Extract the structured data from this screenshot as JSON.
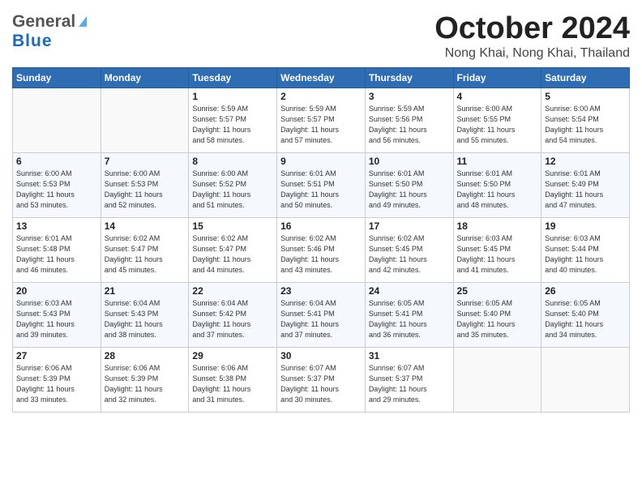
{
  "header": {
    "logo_line1": "General",
    "logo_line2": "Blue",
    "month_title": "October 2024",
    "location": "Nong Khai, Nong Khai, Thailand"
  },
  "weekdays": [
    "Sunday",
    "Monday",
    "Tuesday",
    "Wednesday",
    "Thursday",
    "Friday",
    "Saturday"
  ],
  "weeks": [
    [
      {
        "day": "",
        "info": ""
      },
      {
        "day": "",
        "info": ""
      },
      {
        "day": "1",
        "info": "Sunrise: 5:59 AM\nSunset: 5:57 PM\nDaylight: 11 hours\nand 58 minutes."
      },
      {
        "day": "2",
        "info": "Sunrise: 5:59 AM\nSunset: 5:57 PM\nDaylight: 11 hours\nand 57 minutes."
      },
      {
        "day": "3",
        "info": "Sunrise: 5:59 AM\nSunset: 5:56 PM\nDaylight: 11 hours\nand 56 minutes."
      },
      {
        "day": "4",
        "info": "Sunrise: 6:00 AM\nSunset: 5:55 PM\nDaylight: 11 hours\nand 55 minutes."
      },
      {
        "day": "5",
        "info": "Sunrise: 6:00 AM\nSunset: 5:54 PM\nDaylight: 11 hours\nand 54 minutes."
      }
    ],
    [
      {
        "day": "6",
        "info": "Sunrise: 6:00 AM\nSunset: 5:53 PM\nDaylight: 11 hours\nand 53 minutes."
      },
      {
        "day": "7",
        "info": "Sunrise: 6:00 AM\nSunset: 5:53 PM\nDaylight: 11 hours\nand 52 minutes."
      },
      {
        "day": "8",
        "info": "Sunrise: 6:00 AM\nSunset: 5:52 PM\nDaylight: 11 hours\nand 51 minutes."
      },
      {
        "day": "9",
        "info": "Sunrise: 6:01 AM\nSunset: 5:51 PM\nDaylight: 11 hours\nand 50 minutes."
      },
      {
        "day": "10",
        "info": "Sunrise: 6:01 AM\nSunset: 5:50 PM\nDaylight: 11 hours\nand 49 minutes."
      },
      {
        "day": "11",
        "info": "Sunrise: 6:01 AM\nSunset: 5:50 PM\nDaylight: 11 hours\nand 48 minutes."
      },
      {
        "day": "12",
        "info": "Sunrise: 6:01 AM\nSunset: 5:49 PM\nDaylight: 11 hours\nand 47 minutes."
      }
    ],
    [
      {
        "day": "13",
        "info": "Sunrise: 6:01 AM\nSunset: 5:48 PM\nDaylight: 11 hours\nand 46 minutes."
      },
      {
        "day": "14",
        "info": "Sunrise: 6:02 AM\nSunset: 5:47 PM\nDaylight: 11 hours\nand 45 minutes."
      },
      {
        "day": "15",
        "info": "Sunrise: 6:02 AM\nSunset: 5:47 PM\nDaylight: 11 hours\nand 44 minutes."
      },
      {
        "day": "16",
        "info": "Sunrise: 6:02 AM\nSunset: 5:46 PM\nDaylight: 11 hours\nand 43 minutes."
      },
      {
        "day": "17",
        "info": "Sunrise: 6:02 AM\nSunset: 5:45 PM\nDaylight: 11 hours\nand 42 minutes."
      },
      {
        "day": "18",
        "info": "Sunrise: 6:03 AM\nSunset: 5:45 PM\nDaylight: 11 hours\nand 41 minutes."
      },
      {
        "day": "19",
        "info": "Sunrise: 6:03 AM\nSunset: 5:44 PM\nDaylight: 11 hours\nand 40 minutes."
      }
    ],
    [
      {
        "day": "20",
        "info": "Sunrise: 6:03 AM\nSunset: 5:43 PM\nDaylight: 11 hours\nand 39 minutes."
      },
      {
        "day": "21",
        "info": "Sunrise: 6:04 AM\nSunset: 5:43 PM\nDaylight: 11 hours\nand 38 minutes."
      },
      {
        "day": "22",
        "info": "Sunrise: 6:04 AM\nSunset: 5:42 PM\nDaylight: 11 hours\nand 37 minutes."
      },
      {
        "day": "23",
        "info": "Sunrise: 6:04 AM\nSunset: 5:41 PM\nDaylight: 11 hours\nand 37 minutes."
      },
      {
        "day": "24",
        "info": "Sunrise: 6:05 AM\nSunset: 5:41 PM\nDaylight: 11 hours\nand 36 minutes."
      },
      {
        "day": "25",
        "info": "Sunrise: 6:05 AM\nSunset: 5:40 PM\nDaylight: 11 hours\nand 35 minutes."
      },
      {
        "day": "26",
        "info": "Sunrise: 6:05 AM\nSunset: 5:40 PM\nDaylight: 11 hours\nand 34 minutes."
      }
    ],
    [
      {
        "day": "27",
        "info": "Sunrise: 6:06 AM\nSunset: 5:39 PM\nDaylight: 11 hours\nand 33 minutes."
      },
      {
        "day": "28",
        "info": "Sunrise: 6:06 AM\nSunset: 5:39 PM\nDaylight: 11 hours\nand 32 minutes."
      },
      {
        "day": "29",
        "info": "Sunrise: 6:06 AM\nSunset: 5:38 PM\nDaylight: 11 hours\nand 31 minutes."
      },
      {
        "day": "30",
        "info": "Sunrise: 6:07 AM\nSunset: 5:37 PM\nDaylight: 11 hours\nand 30 minutes."
      },
      {
        "day": "31",
        "info": "Sunrise: 6:07 AM\nSunset: 5:37 PM\nDaylight: 11 hours\nand 29 minutes."
      },
      {
        "day": "",
        "info": ""
      },
      {
        "day": "",
        "info": ""
      }
    ]
  ]
}
